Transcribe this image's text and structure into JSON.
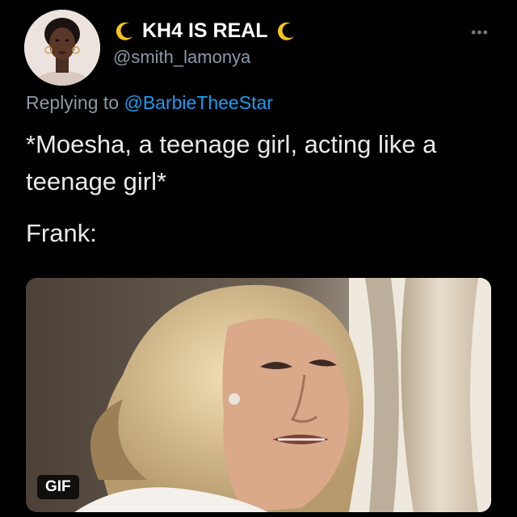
{
  "author": {
    "display_name": "KH4 IS REAL",
    "handle": "@smith_lamonya",
    "name_emoji": "crescent-moon-icon"
  },
  "reply": {
    "prefix": "Replying to",
    "mention": "@BarbieTheeStar"
  },
  "tweet": {
    "text": "*Moesha, a teenage girl, acting like a teenage girl*",
    "text2": "Frank:"
  },
  "media": {
    "badge": "GIF"
  },
  "colors": {
    "background": "#000000",
    "text_primary": "#e7e9ea",
    "text_secondary": "#8b98a5",
    "link": "#1d9bf0",
    "moon": "#f5c518"
  }
}
